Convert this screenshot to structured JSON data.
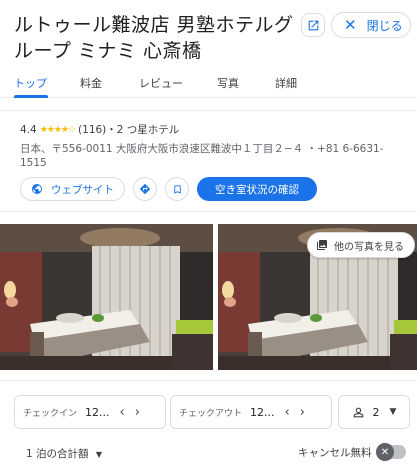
{
  "header": {
    "title": "ルトゥール難波店 男塾ホテルグループ ミナミ 心斎橋",
    "close_label": "閉じる"
  },
  "tabs": [
    {
      "label": "トップ",
      "active": true
    },
    {
      "label": "料金",
      "active": false
    },
    {
      "label": "レビュー",
      "active": false
    },
    {
      "label": "写真",
      "active": false
    },
    {
      "label": "詳細",
      "active": false
    }
  ],
  "info": {
    "rating": "4.4",
    "reviews": "(116)",
    "category": "・2 つ星ホテル",
    "address": "日本、〒556-0011 大阪府大阪市浪速区難波中１丁目２−４ ・+81 6-6631-1515",
    "website_label": "ウェブサイト",
    "availability_label": "空き室状況の確認"
  },
  "photos": {
    "more_label": "他の写真を見る"
  },
  "booking": {
    "checkin_label": "チェックイン",
    "checkin_value": "12...",
    "checkout_label": "チェックアウト",
    "checkout_value": "12...",
    "guests_value": "2",
    "total_label": "1 泊の合計額",
    "cancel_label": "キャンセル無料"
  },
  "colors": {
    "accent": "#1a73e8",
    "star": "#fbbc04"
  }
}
